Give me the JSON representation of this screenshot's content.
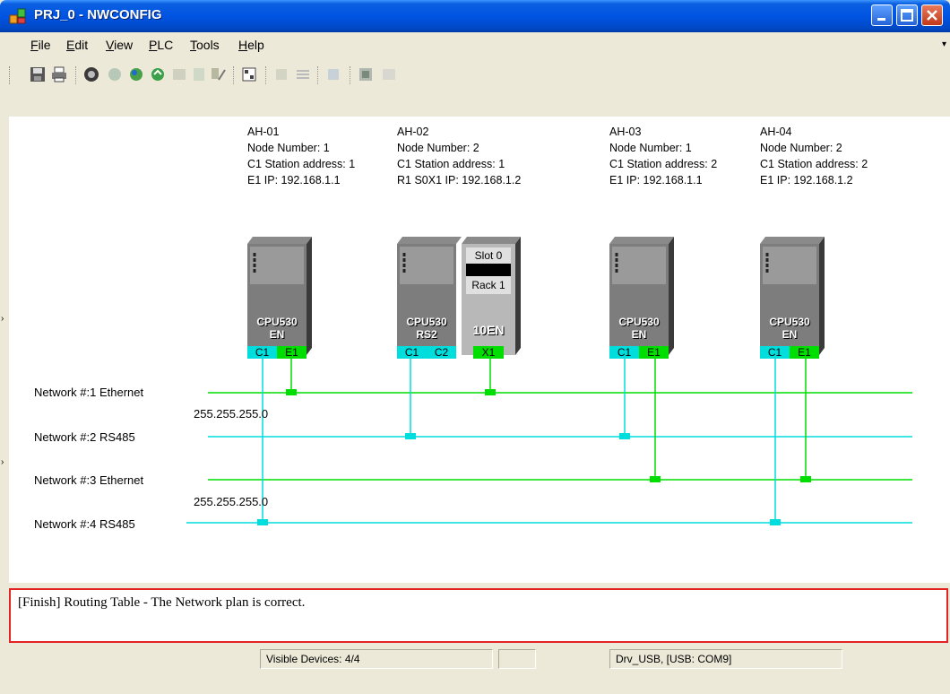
{
  "window": {
    "title": "PRJ_0 - NWCONFIG"
  },
  "menu": [
    "File",
    "Edit",
    "View",
    "PLC",
    "Tools",
    "Help"
  ],
  "menu_accels": [
    "F",
    "E",
    "V",
    "P",
    "T",
    "H"
  ],
  "toolbar": {
    "icons": [
      "save-icon",
      "print-icon",
      "online-icon",
      "download-icon",
      "upload-icon",
      "monitor-icon",
      "compare-icon",
      "device-list-icon",
      "properties-icon",
      "network-icon",
      "routing-icon",
      "zoom-icon",
      "diagnose-icon",
      "help-icon"
    ]
  },
  "devices": [
    {
      "name": "AH-01",
      "node": "Node Number: 1",
      "c1": "C1 Station address: 1",
      "ip": "E1 IP: 192.168.1.1",
      "model": "CPU530",
      "variant": "EN",
      "ports": [
        "C1",
        "E1"
      ]
    },
    {
      "name": "AH-02",
      "node": "Node Number: 2",
      "c1": "C1 Station address: 1",
      "ip": "R1 S0X1 IP: 192.168.1.2",
      "model": "CPU530",
      "variant": "RS2",
      "ports": [
        "C1",
        "C2"
      ],
      "module": {
        "slot": "Slot 0",
        "rack": "Rack 1",
        "name": "10EN",
        "port": "X1"
      }
    },
    {
      "name": "AH-03",
      "node": "Node Number: 1",
      "c1": "C1 Station address: 2",
      "ip": "E1 IP: 192.168.1.1",
      "model": "CPU530",
      "variant": "EN",
      "ports": [
        "C1",
        "E1"
      ]
    },
    {
      "name": "AH-04",
      "node": "Node Number: 2",
      "c1": "C1 Station address: 2",
      "ip": "E1 IP: 192.168.1.2",
      "model": "CPU530",
      "variant": "EN",
      "ports": [
        "C1",
        "E1"
      ]
    }
  ],
  "networks": [
    {
      "label": "Network #:1  Ethernet",
      "mask": "255.255.255.0",
      "type": "ethernet"
    },
    {
      "label": "Network #:2  RS485",
      "type": "rs485"
    },
    {
      "label": "Network #:3  Ethernet",
      "mask": "255.255.255.0",
      "type": "ethernet"
    },
    {
      "label": "Network #:4  RS485",
      "type": "rs485"
    }
  ],
  "colors": {
    "ethernet": "#00dd00",
    "rs485": "#00dddd",
    "highlight": "#e32424",
    "titlebar": "#0054e3"
  },
  "message": "[Finish] Routing Table - The Network plan is correct.",
  "status": {
    "visible": "Visible Devices: 4/4",
    "driver": "Drv_USB, [USB: COM9]"
  }
}
